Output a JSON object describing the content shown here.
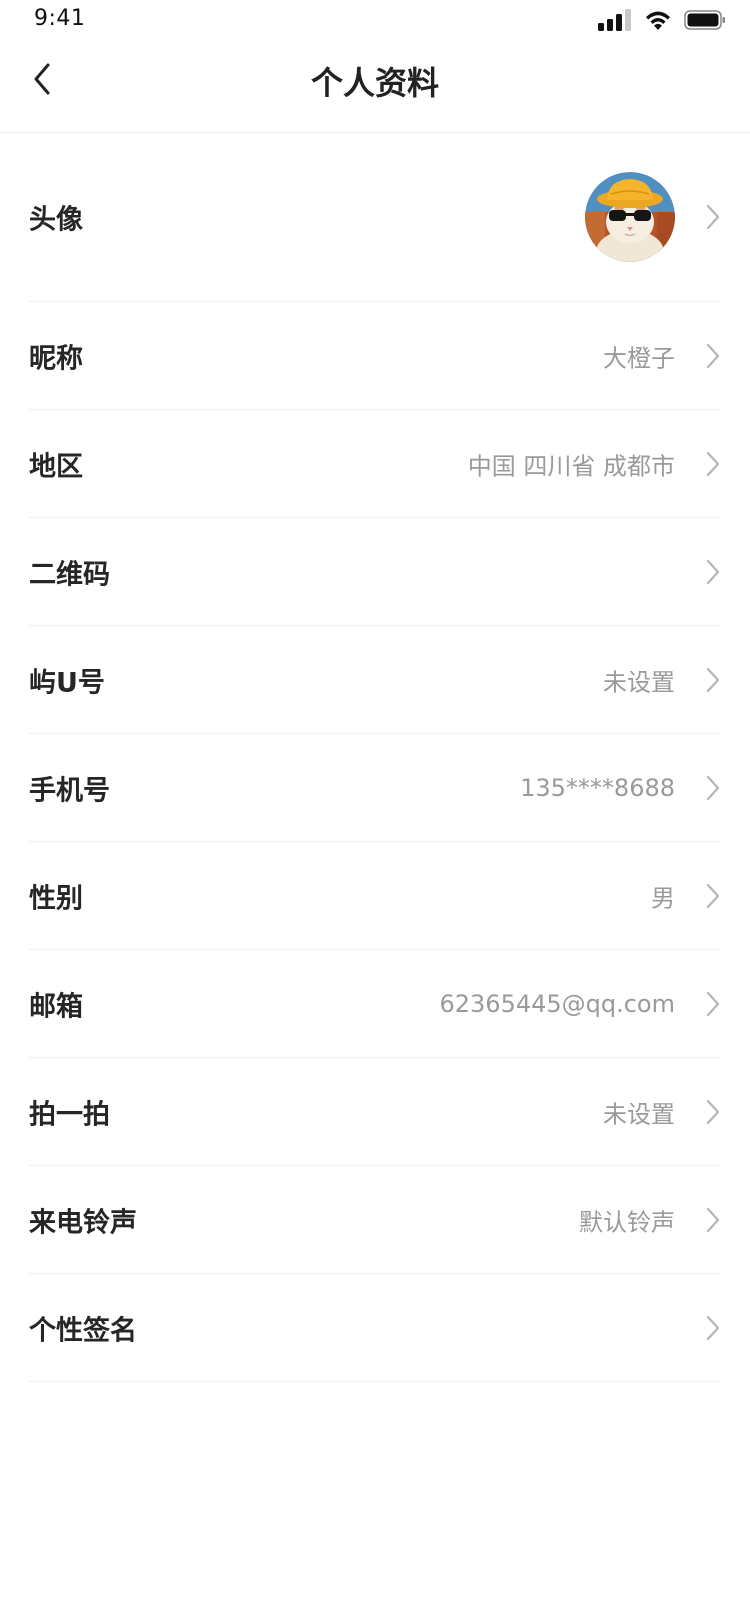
{
  "status_bar": {
    "time": "9:41",
    "icons": [
      "signal-icon",
      "wifi-icon",
      "battery-icon"
    ]
  },
  "header": {
    "title": "个人资料",
    "back_icon": "chevron-left-icon"
  },
  "rows": [
    {
      "label": "头像",
      "value": "",
      "type": "avatar"
    },
    {
      "label": "昵称",
      "value": "大橙子"
    },
    {
      "label": "地区",
      "value": "中国 四川省 成都市"
    },
    {
      "label": "二维码",
      "value": ""
    },
    {
      "label": "屿U号",
      "value": "未设置"
    },
    {
      "label": "手机号",
      "value": "135****8688"
    },
    {
      "label": "性别",
      "value": "男"
    },
    {
      "label": "邮箱",
      "value": "62365445@qq.com"
    },
    {
      "label": "拍一拍",
      "value": "未设置"
    },
    {
      "label": "来电铃声",
      "value": "默认铃声"
    },
    {
      "label": "个性签名",
      "value": ""
    }
  ],
  "colors": {
    "label": "#262626",
    "value": "#9a9a9a",
    "divider": "#eeeeee",
    "chevron": "#b5b5b5",
    "background": "#ffffff"
  }
}
